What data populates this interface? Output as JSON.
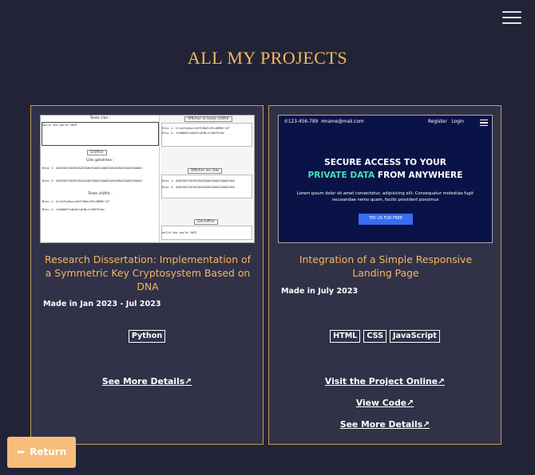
{
  "page": {
    "title": "ALL MY PROJECTS",
    "accent_color": "#f4b860",
    "background_color": "#222336"
  },
  "header": {
    "menu_icon": "hamburger-menu-icon"
  },
  "projects": [
    {
      "title": "Research Dissertation: Implementation of a Symmetric Key Cryptosystem Based on DNA",
      "date": "Made in Jan 2023 - Jul 2023",
      "tags": [
        "Python"
      ],
      "links": {
        "details": "See More Details↗"
      },
      "thumbnail": {
        "plaintext_label": "Texte clair :",
        "plaintext_value": "hello the world 2023",
        "encrypt_button": "Chiffrer",
        "keys_label": "Clés générées :",
        "key1": "Bloc 1: AUGCGUCGGCUCGAUCGGAUCGAUGCAUAGCUAGCUAUGCGAUGCUAUGC",
        "key2": "Bloc 2: AUGCGUCGGCUCGAUCGGAUCGAUGCAUAGCUAGCUAUGCGAUGCUAUGC",
        "cipher_label": "Texte chiffré :",
        "cipher1": "Bloc 1: U!4v2%s8xcit#fEJDeCuPLLXDMD!!AT",
        "cipher2": "Bloc 2: tvU0#sPcz#z#lnqlNLrLSAOTVvbv",
        "right_button1": "Afficher le texte chiffré",
        "right_line1": "Bloc 1: U!4v2%s8xcit#fEJDeCuPLLXDMD!!AT",
        "right_line2": "Bloc 2: tvU0#sPcz#z#lnqlNLrLSAOTVvbv",
        "right_button2": "Afficher les clés",
        "right_line3": "Bloc 1: AUGCGUCGGCUCGAUCGGAUCGAUGCAUAGCUAG",
        "right_line4": "Bloc 2: AUGCGUCGGCUCGAUCGGAUCGAUGCAUAGCUAG",
        "right_button3": "Déchiffrer",
        "right_line5": "hello the world 2023"
      }
    },
    {
      "title": "Integration of a Simple Responsive Landing Page",
      "date": "Made in July 2023",
      "tags": [
        "HTML",
        "CSS",
        "JavaScript"
      ],
      "links": {
        "visit": "Visit the Project Online↗",
        "code": "View Code↗",
        "details": "See More Details↗"
      },
      "thumbnail": {
        "phone": "123-456-789",
        "email": "name@mail.com",
        "register": "Register",
        "login": "Login",
        "hero_line1": "SECURE ACCESS TO YOUR",
        "hero_highlight": "PRIVATE DATA",
        "hero_rest": "FROM ANYWHERE",
        "subtext": "Lorem ipsum dolor sit amet consectetur, adipisicing elit. Consequatur molestias fugit recusandae nemo quam, facilis provident possimus",
        "cta": "TRY US FOR FREE"
      }
    }
  ],
  "footer": {
    "return_label": "Return",
    "return_icon": "share-arrow-icon"
  }
}
